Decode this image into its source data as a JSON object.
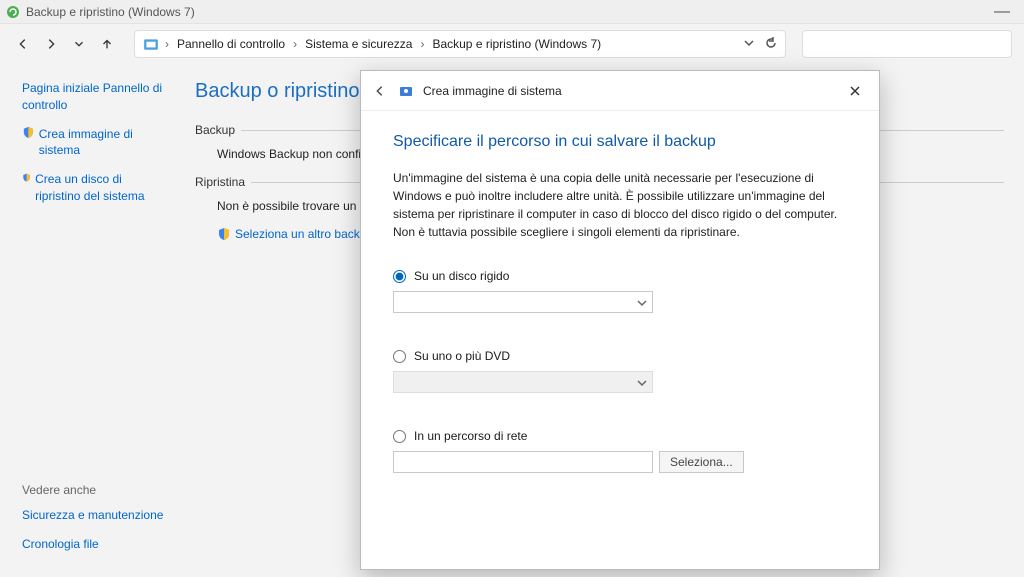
{
  "window": {
    "title": "Backup e ripristino (Windows 7)"
  },
  "breadcrumbs": [
    "Pannello di controllo",
    "Sistema e sicurezza",
    "Backup e ripristino (Windows 7)"
  ],
  "sidebar": {
    "home": "Pagina iniziale Pannello di controllo",
    "link_create_image": "Crea immagine di sistema",
    "link_create_disc": "Crea un disco di ripristino del sistema",
    "see_also_hdr": "Vedere anche",
    "see_also_1": "Sicurezza e manutenzione",
    "see_also_2": "Cronologia file"
  },
  "content": {
    "heading": "Backup o ripristino dei file",
    "section_backup": "Backup",
    "backup_status": "Windows Backup non configurato",
    "section_restore": "Ripristina",
    "restore_status": "Non è possibile trovare un backup",
    "restore_link": "Seleziona un altro backup per"
  },
  "wizard": {
    "title": "Crea immagine di sistema",
    "heading": "Specificare il percorso in cui salvare il backup",
    "desc": "Un'immagine del sistema è una copia delle unità necessarie per l'esecuzione di Windows e può inoltre includere altre unità. È possibile utilizzare un'immagine del sistema per ripristinare il computer in caso di blocco del disco rigido o del computer. Non è tuttavia possibile scegliere i singoli elementi da ripristinare.",
    "opt_disk": "Su un disco rigido",
    "opt_dvd": "Su uno o più DVD",
    "opt_net": "In un percorso di rete",
    "btn_select": "Seleziona..."
  }
}
